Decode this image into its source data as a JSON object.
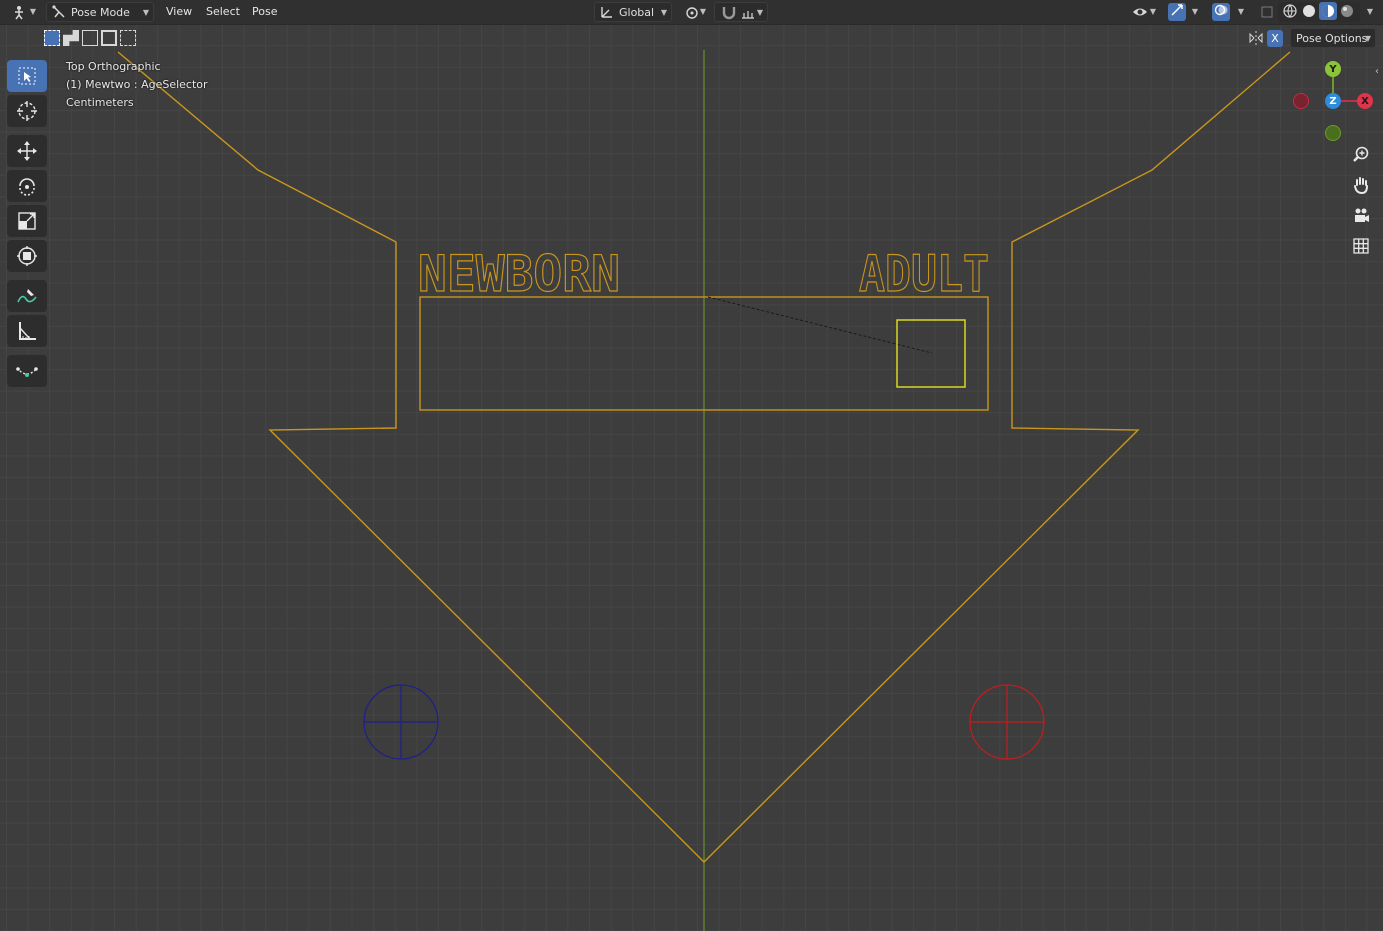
{
  "header": {
    "editor_type_icon": "pose-armature-icon",
    "mode": "Pose Mode",
    "menus": [
      "View",
      "Select",
      "Pose"
    ],
    "orientation": "Global",
    "pose_options_label": "Pose Options",
    "x_mirror_label": "X"
  },
  "overlay": {
    "view_name": "Top Orthographic",
    "object_info": "(1) Mewtwo : AgeSelector",
    "units": "Centimeters"
  },
  "toolbar": {
    "tools": [
      "select-box",
      "cursor",
      "move",
      "rotate",
      "scale",
      "transform",
      "annotate",
      "measure",
      "bone-envelope"
    ],
    "active": "select-box"
  },
  "gizmo": {
    "y": "Y",
    "z": "Z",
    "x": "X"
  },
  "scene": {
    "text_left": "NEWBORN",
    "text_right": "ADULT",
    "colors": {
      "outline": "#c9961c",
      "selected": "#e5e21f",
      "axis_y": "#6a8e2b",
      "target_left": "#1e1e8f",
      "target_right": "#c21d1d"
    }
  },
  "colors": {
    "accent": "#4772b3",
    "header_bg": "#303030",
    "viewport_bg": "#3d3d3d"
  }
}
